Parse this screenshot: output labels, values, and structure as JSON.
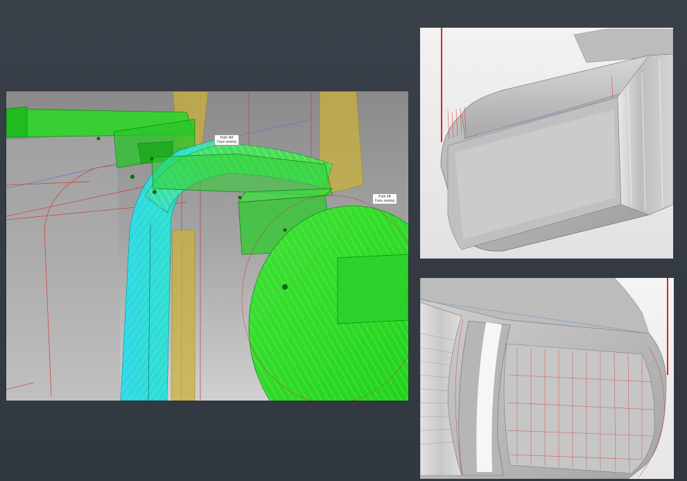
{
  "main_view": {
    "labels": [
      {
        "line1": "Path 4M",
        "line2": "Face sewing"
      },
      {
        "line1": "Path 4B",
        "line2": "Face sewing"
      }
    ]
  },
  "colors": {
    "background": "#363c44",
    "toolpath_green": "#22dd22",
    "toolpath_cyan": "#22dddd",
    "holder_yellow": "#c8b23c",
    "boundary_red": "#e02020",
    "surface_grey": "#b8b8b8"
  }
}
